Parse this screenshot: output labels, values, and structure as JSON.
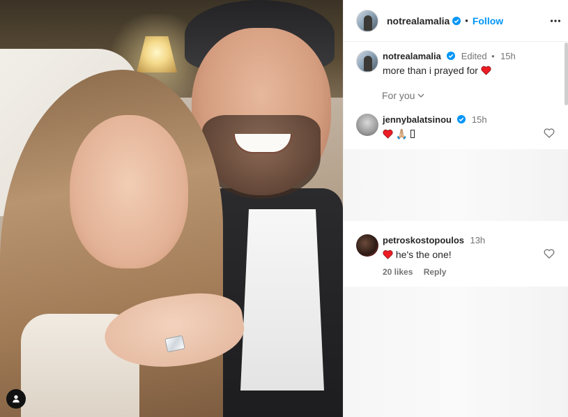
{
  "post": {
    "author": "notrealamalia",
    "follow_label": "Follow",
    "separator": "•"
  },
  "caption": {
    "author": "notrealamalia",
    "edited": "Edited",
    "time": "15h",
    "text": "more than i prayed for"
  },
  "for_you_label": "For you",
  "comments": [
    {
      "author": "jennybalatsinou",
      "time": "15h",
      "text": "",
      "emoji_extra": "🙏🏼"
    },
    {
      "author": "petroskostopoulos",
      "time": "13h",
      "text": "he's the one!",
      "likes": "20 likes",
      "reply_label": "Reply"
    }
  ],
  "colors": {
    "accent": "#0095f6",
    "heart": "#ed1c24",
    "verified": "#0095f6"
  },
  "icons": {
    "more": "three-dots-icon",
    "verified": "verified-badge-icon",
    "heart": "heart-outline-icon",
    "tag": "user-tag-icon"
  }
}
